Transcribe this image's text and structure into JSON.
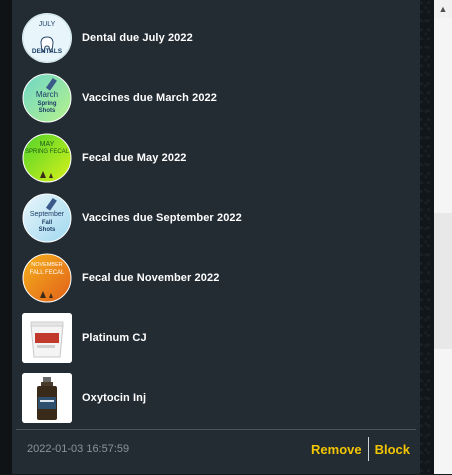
{
  "notifications": [
    {
      "label": "Dental due July 2022",
      "icon": "july-dentals-icon",
      "thumb_lines": [
        "JULY",
        "DENTALS"
      ],
      "thumb_bg": "#e8f6fb",
      "thumb_color": "#1c3f66",
      "shape": "round"
    },
    {
      "label": "Vaccines due March 2022",
      "icon": "march-spring-shots-icon",
      "thumb_lines": [
        "March",
        "Spring",
        "Shots"
      ],
      "thumb_bg": "#7fe8b9",
      "thumb_color": "#1d3d66",
      "shape": "round"
    },
    {
      "label": "Fecal due May 2022",
      "icon": "may-spring-fecal-icon",
      "thumb_lines": [
        "MAY",
        "SPRING FECAL"
      ],
      "thumb_bg": "#7ee01e",
      "thumb_color": "#1e5c1a",
      "shape": "round"
    },
    {
      "label": "Vaccines due September 2022",
      "icon": "september-fall-shots-icon",
      "thumb_lines": [
        "September",
        "Fall",
        "Shots"
      ],
      "thumb_bg": "#bfe6f6",
      "thumb_color": "#1d3d66",
      "shape": "round"
    },
    {
      "label": "Fecal due November 2022",
      "icon": "november-fall-fecal-icon",
      "thumb_lines": [
        "NOVEMBER",
        "FALL FECAL"
      ],
      "thumb_bg": "#f28a18",
      "thumb_color": "#ffffff",
      "shape": "round"
    },
    {
      "label": "Platinum CJ",
      "icon": "platinum-cj-bucket-icon",
      "thumb_lines": [],
      "thumb_bg": "#ffffff",
      "thumb_color": "#c0392b",
      "shape": "square"
    },
    {
      "label": "Oxytocin Inj",
      "icon": "oxytocin-bottle-icon",
      "thumb_lines": [],
      "thumb_bg": "#ffffff",
      "thumb_color": "#3a2a1a",
      "shape": "square"
    }
  ],
  "footer": {
    "timestamp": "2022-01-03 16:57:59",
    "remove_label": "Remove",
    "block_label": "Block"
  },
  "colors": {
    "panel_bg": "#232b33",
    "accent": "#f2c500",
    "text": "#ffffff",
    "muted": "#8a939b"
  }
}
